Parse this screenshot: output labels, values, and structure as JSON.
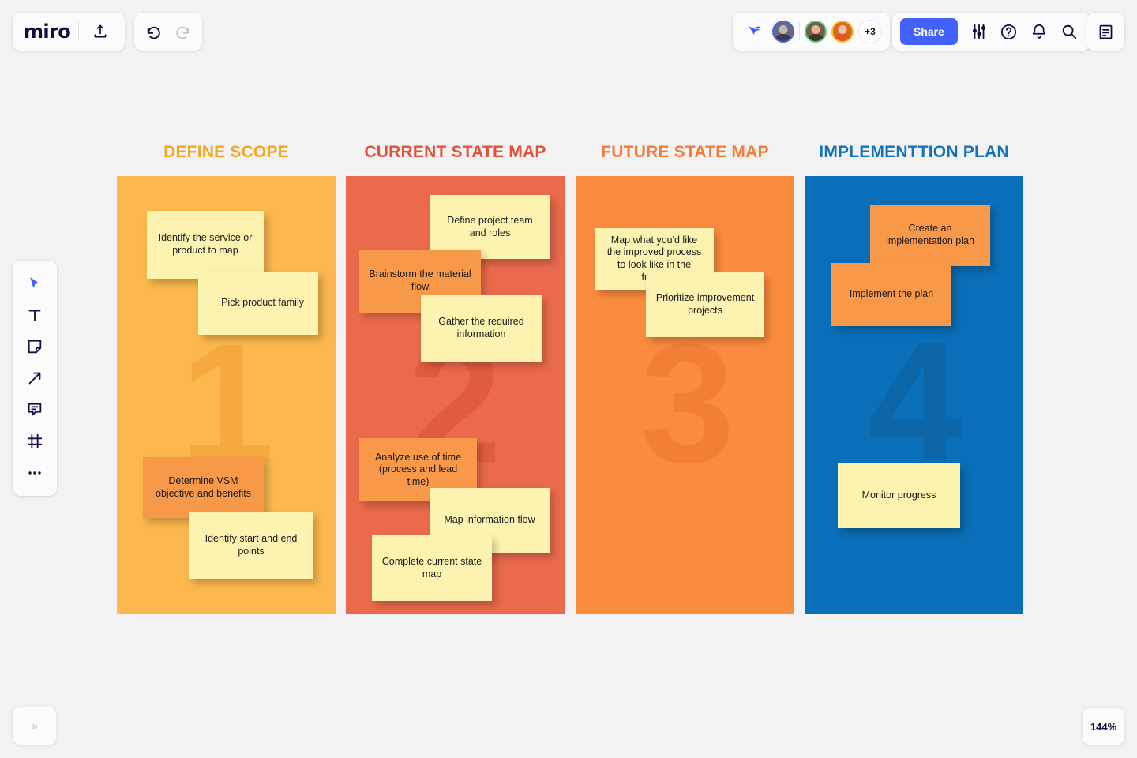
{
  "app": {
    "logo": "miro",
    "zoom_level": "144%",
    "collapse_label": "»"
  },
  "toolbar_top_left": {
    "upload_icon": "upload-icon",
    "undo_icon": "undo-icon",
    "redo_icon": "redo-icon"
  },
  "toolbar_top_right": {
    "cursor_icon": "cursor-pointer-icon",
    "avatars": [
      {
        "name": "collaborator-1",
        "ring": "#4262ff"
      },
      {
        "name": "collaborator-2",
        "ring": "#46d877"
      },
      {
        "name": "collaborator-3",
        "ring": "#f5c51e"
      }
    ],
    "avatar_overflow": "+3",
    "share_label": "Share",
    "settings_icon": "sliders-icon",
    "help_icon": "help-circle-icon",
    "notifications_icon": "bell-icon",
    "search_icon": "search-icon",
    "notes_icon": "document-icon"
  },
  "tool_rail": [
    {
      "label": "select-tool",
      "icon": "cursor-arrow-icon"
    },
    {
      "label": "text-tool",
      "icon": "text-t-icon"
    },
    {
      "label": "sticky-note-tool",
      "icon": "sticky-note-icon"
    },
    {
      "label": "arrow-tool",
      "icon": "arrow-icon"
    },
    {
      "label": "comment-tool",
      "icon": "comment-icon"
    },
    {
      "label": "frame-tool",
      "icon": "frame-icon"
    },
    {
      "label": "more-tools",
      "icon": "ellipsis-icon"
    }
  ],
  "board": {
    "columns": [
      {
        "title": "DEFINE SCOPE",
        "title_color": "#f5a623",
        "bg": "#fcb84e",
        "number": "1",
        "number_color": "#f5a93f",
        "notes": [
          {
            "text": "Identify the service or product to map",
            "color": "yellow",
            "align": "center"
          },
          {
            "text": "Pick product family",
            "color": "yellow",
            "align": "right"
          },
          {
            "text": "Determine VSM objective and benefits",
            "color": "orange",
            "align": "center"
          },
          {
            "text": "Identify start and end points",
            "color": "yellow",
            "align": "center"
          }
        ]
      },
      {
        "title": "CURRENT STATE MAP",
        "title_color": "#e4503a",
        "bg": "#eb6a4d",
        "number": "2",
        "number_color": "#e05c41",
        "notes": [
          {
            "text": "Define project team and roles",
            "color": "yellow",
            "align": "center"
          },
          {
            "text": "Brainstorm the material flow",
            "color": "orange",
            "align": "center"
          },
          {
            "text": "Gather the required information",
            "color": "yellow",
            "align": "center"
          },
          {
            "text": "Analyze use of time (process and lead time)",
            "color": "orange",
            "align": "center"
          },
          {
            "text": "Map information flow",
            "color": "yellow",
            "align": "center"
          },
          {
            "text": "Complete current state map",
            "color": "yellow",
            "align": "center"
          }
        ]
      },
      {
        "title": "FUTURE STATE MAP",
        "title_color": "#f57b36",
        "bg": "#fb8c3f",
        "number": "3",
        "number_color": "#f17f36",
        "notes": [
          {
            "text": "Map what you'd like the improved process to look like in the future",
            "color": "yellow",
            "align": "center"
          },
          {
            "text": "Prioritize improvement projects",
            "color": "yellow",
            "align": "center"
          }
        ]
      },
      {
        "title": "IMPLEMENTTION PLAN",
        "title_color": "#1472b8",
        "bg": "#0a6fb8",
        "number": "4",
        "number_color": "#0b65a6",
        "notes": [
          {
            "text": "Create an implementation plan",
            "color": "orange",
            "align": "center"
          },
          {
            "text": "Implement the plan",
            "color": "orange",
            "align": "center"
          },
          {
            "text": "Monitor progress",
            "color": "yellow",
            "align": "center"
          }
        ]
      }
    ]
  }
}
